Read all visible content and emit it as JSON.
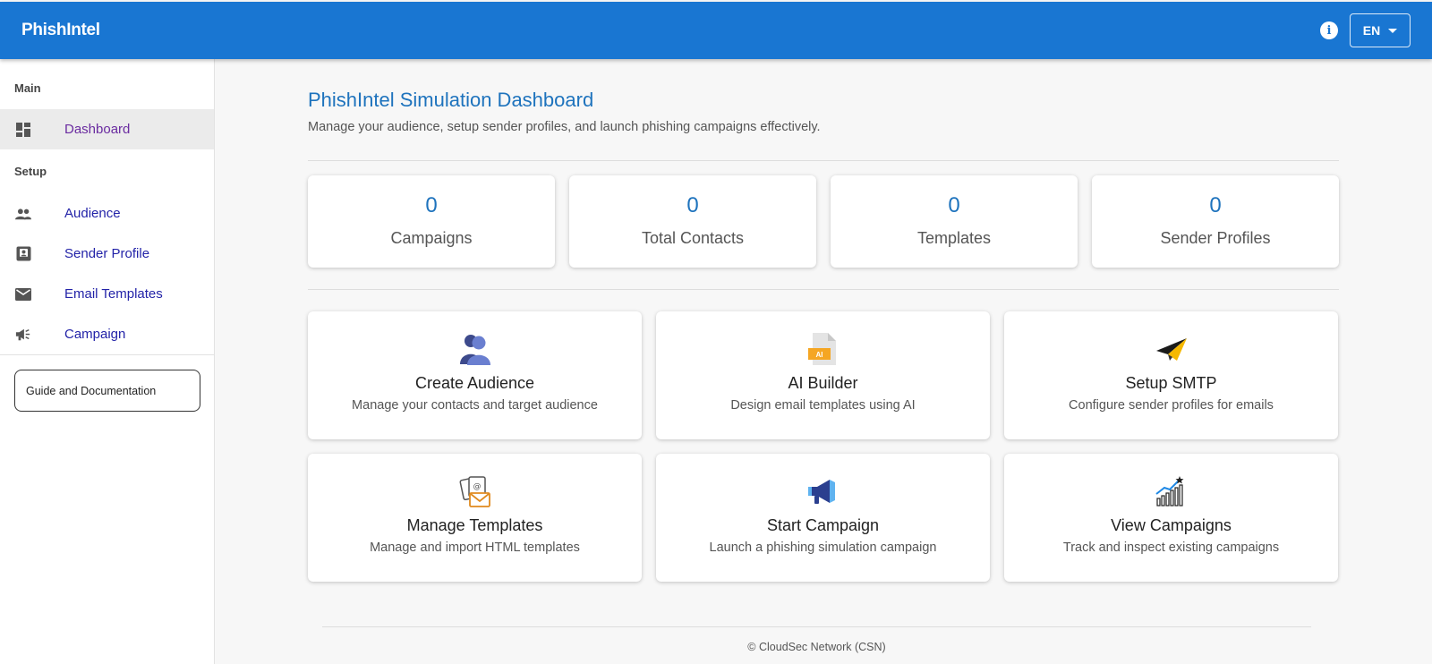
{
  "header": {
    "brand": "PhishIntel",
    "language": "EN"
  },
  "sidebar": {
    "sections": {
      "main": "Main",
      "setup": "Setup"
    },
    "items": [
      {
        "label": "Dashboard",
        "icon": "dashboard-icon"
      },
      {
        "label": "Audience",
        "icon": "people-icon"
      },
      {
        "label": "Sender Profile",
        "icon": "contact-mail-icon"
      },
      {
        "label": "Email Templates",
        "icon": "envelope-icon"
      },
      {
        "label": "Campaign",
        "icon": "megaphone-icon"
      }
    ],
    "guide_label": "Guide and Documentation"
  },
  "main": {
    "title": "PhishIntel Simulation Dashboard",
    "subtitle": "Manage your audience, setup sender profiles, and launch phishing campaigns effectively.",
    "stats": [
      {
        "value": "0",
        "label": "Campaigns"
      },
      {
        "value": "0",
        "label": "Total Contacts"
      },
      {
        "value": "0",
        "label": "Templates"
      },
      {
        "value": "0",
        "label": "Sender Profiles"
      }
    ],
    "actions": [
      {
        "title": "Create Audience",
        "desc": "Manage your contacts and target audience",
        "icon": "audience-icon"
      },
      {
        "title": "AI Builder",
        "desc": "Design email templates using AI",
        "icon": "ai-document-icon",
        "icon_text": "AI"
      },
      {
        "title": "Setup SMTP",
        "desc": "Configure sender profiles for emails",
        "icon": "paper-plane-icon"
      },
      {
        "title": "Manage Templates",
        "desc": "Manage and import HTML templates",
        "icon": "email-templates-icon"
      },
      {
        "title": "Start Campaign",
        "desc": "Launch a phishing simulation campaign",
        "icon": "megaphone-icon"
      },
      {
        "title": "View Campaigns",
        "desc": "Track and inspect existing campaigns",
        "icon": "growth-chart-icon"
      }
    ]
  },
  "footer": {
    "text": "© CloudSec Network (CSN)"
  },
  "colors": {
    "primary": "#1976d2",
    "title_blue": "#1e73bd",
    "nav_link": "#2323a8",
    "nav_active": "#6a2ba0"
  }
}
